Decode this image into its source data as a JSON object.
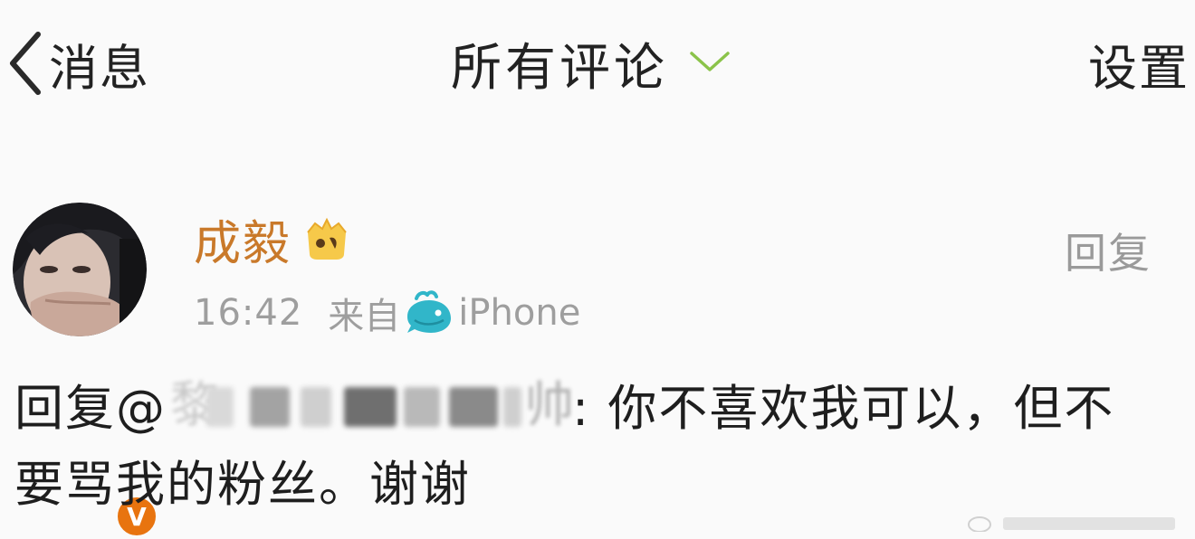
{
  "header": {
    "back_label": "消息",
    "title": "所有评论",
    "settings_label": "设置"
  },
  "comment": {
    "username": "成毅",
    "reply_label": "回复",
    "time": "16:42",
    "from_label": "来自",
    "device": "iPhone",
    "reply_prefix": "回复@",
    "mention_visible_start": "黎",
    "mention_visible_end": "帅",
    "text_line1": ": 你不喜欢我可以，但不",
    "text_line2": "要骂我的粉丝。谢谢",
    "verify_badge": "V"
  },
  "colors": {
    "username": "#c9792a",
    "meta": "#9e9e9e",
    "badge": "#e8740f",
    "chevron": "#8bc34a"
  },
  "icons": {
    "back": "chevron-left-icon",
    "title_dropdown": "chevron-down-icon",
    "member": "member-crown-icon",
    "client": "whale-icon",
    "verified": "verified-v-icon"
  }
}
